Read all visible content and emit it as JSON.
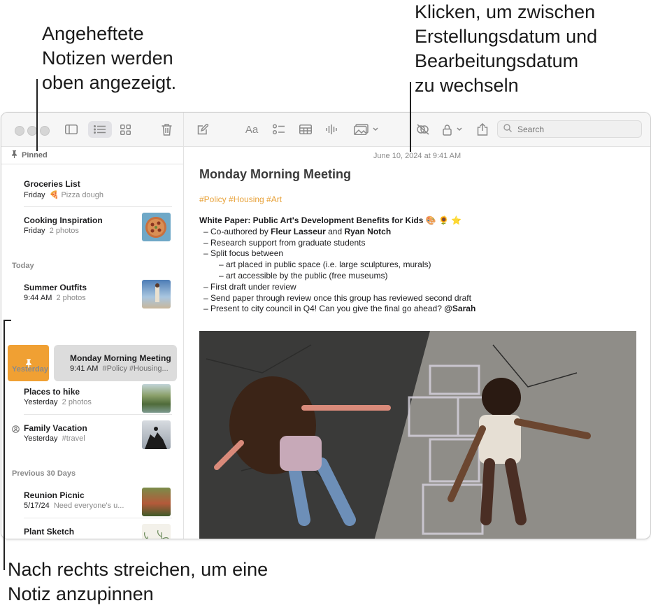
{
  "callouts": {
    "pinned": "Angeheftete\nNotizen werden\noben angezeigt.",
    "date_toggle": "Klicken, um zwischen\nErstellungsdatum und\nBearbeitungsdatum\nzu wechseln",
    "swipe": "Nach rechts streichen, um eine\nNotiz anzupinnen"
  },
  "toolbar": {
    "search_placeholder": "Search",
    "icons": [
      "sidebar-toggle-icon",
      "list-view-icon",
      "gallery-view-icon",
      "trash-icon",
      "compose-icon",
      "format-icon",
      "checklist-icon",
      "table-icon",
      "audio-icon",
      "media-icon",
      "collaborate-icon",
      "lock-icon",
      "share-icon",
      "search-icon"
    ]
  },
  "sidebar": {
    "pinned_label": "Pinned",
    "sections": {
      "today": "Today",
      "yesterday": "Yesterday",
      "previous": "Previous 30 Days"
    },
    "notes": {
      "groceries": {
        "title": "Groceries List",
        "date": "Friday",
        "preview": "🍕 Pizza dough"
      },
      "cooking": {
        "title": "Cooking Inspiration",
        "date": "Friday",
        "preview": "2 photos"
      },
      "summer": {
        "title": "Summer Outfits",
        "date": "9:44 AM",
        "preview": "2 photos"
      },
      "monday": {
        "title": "Monday Morning Meeting",
        "date": "9:41 AM",
        "preview": "#Policy #Housing..."
      },
      "hike": {
        "title": "Places to hike",
        "date": "Yesterday",
        "preview": "2 photos"
      },
      "vacation": {
        "title": "Family Vacation",
        "date": "Yesterday",
        "preview": "#travel"
      },
      "reunion": {
        "title": "Reunion Picnic",
        "date": "5/17/24",
        "preview": "Need everyone's u..."
      },
      "plant": {
        "title": "Plant Sketch"
      }
    }
  },
  "editor": {
    "date": "June 10, 2024 at 9:41 AM",
    "title": "Monday Morning Meeting",
    "tags": "#Policy #Housing #Art",
    "heading": "White Paper: Public Art's Development Benefits for Kids 🎨 🌻 ⭐",
    "l1a": "–  Co-authored by ",
    "l1b": "Fleur Lasseur",
    "l1c": " and ",
    "l1d": "Ryan Notch",
    "l2": "–  Research support from graduate students",
    "l3": "–  Split focus between",
    "l4": "–  art placed in public space (i.e. large sculptures, murals)",
    "l5": "–  art accessible by the public (free museums)",
    "l6": "–  First draft under review",
    "l7": "–  Send paper through review once this group has reviewed second draft",
    "l8a": "–  Present to city council in Q4! Can you give the final go ahead? ",
    "l8b": "@Sarah"
  },
  "colors": {
    "accent": "#e8a23a",
    "pin_action": "#f0a033",
    "selected_bg": "#dcdcdc"
  }
}
